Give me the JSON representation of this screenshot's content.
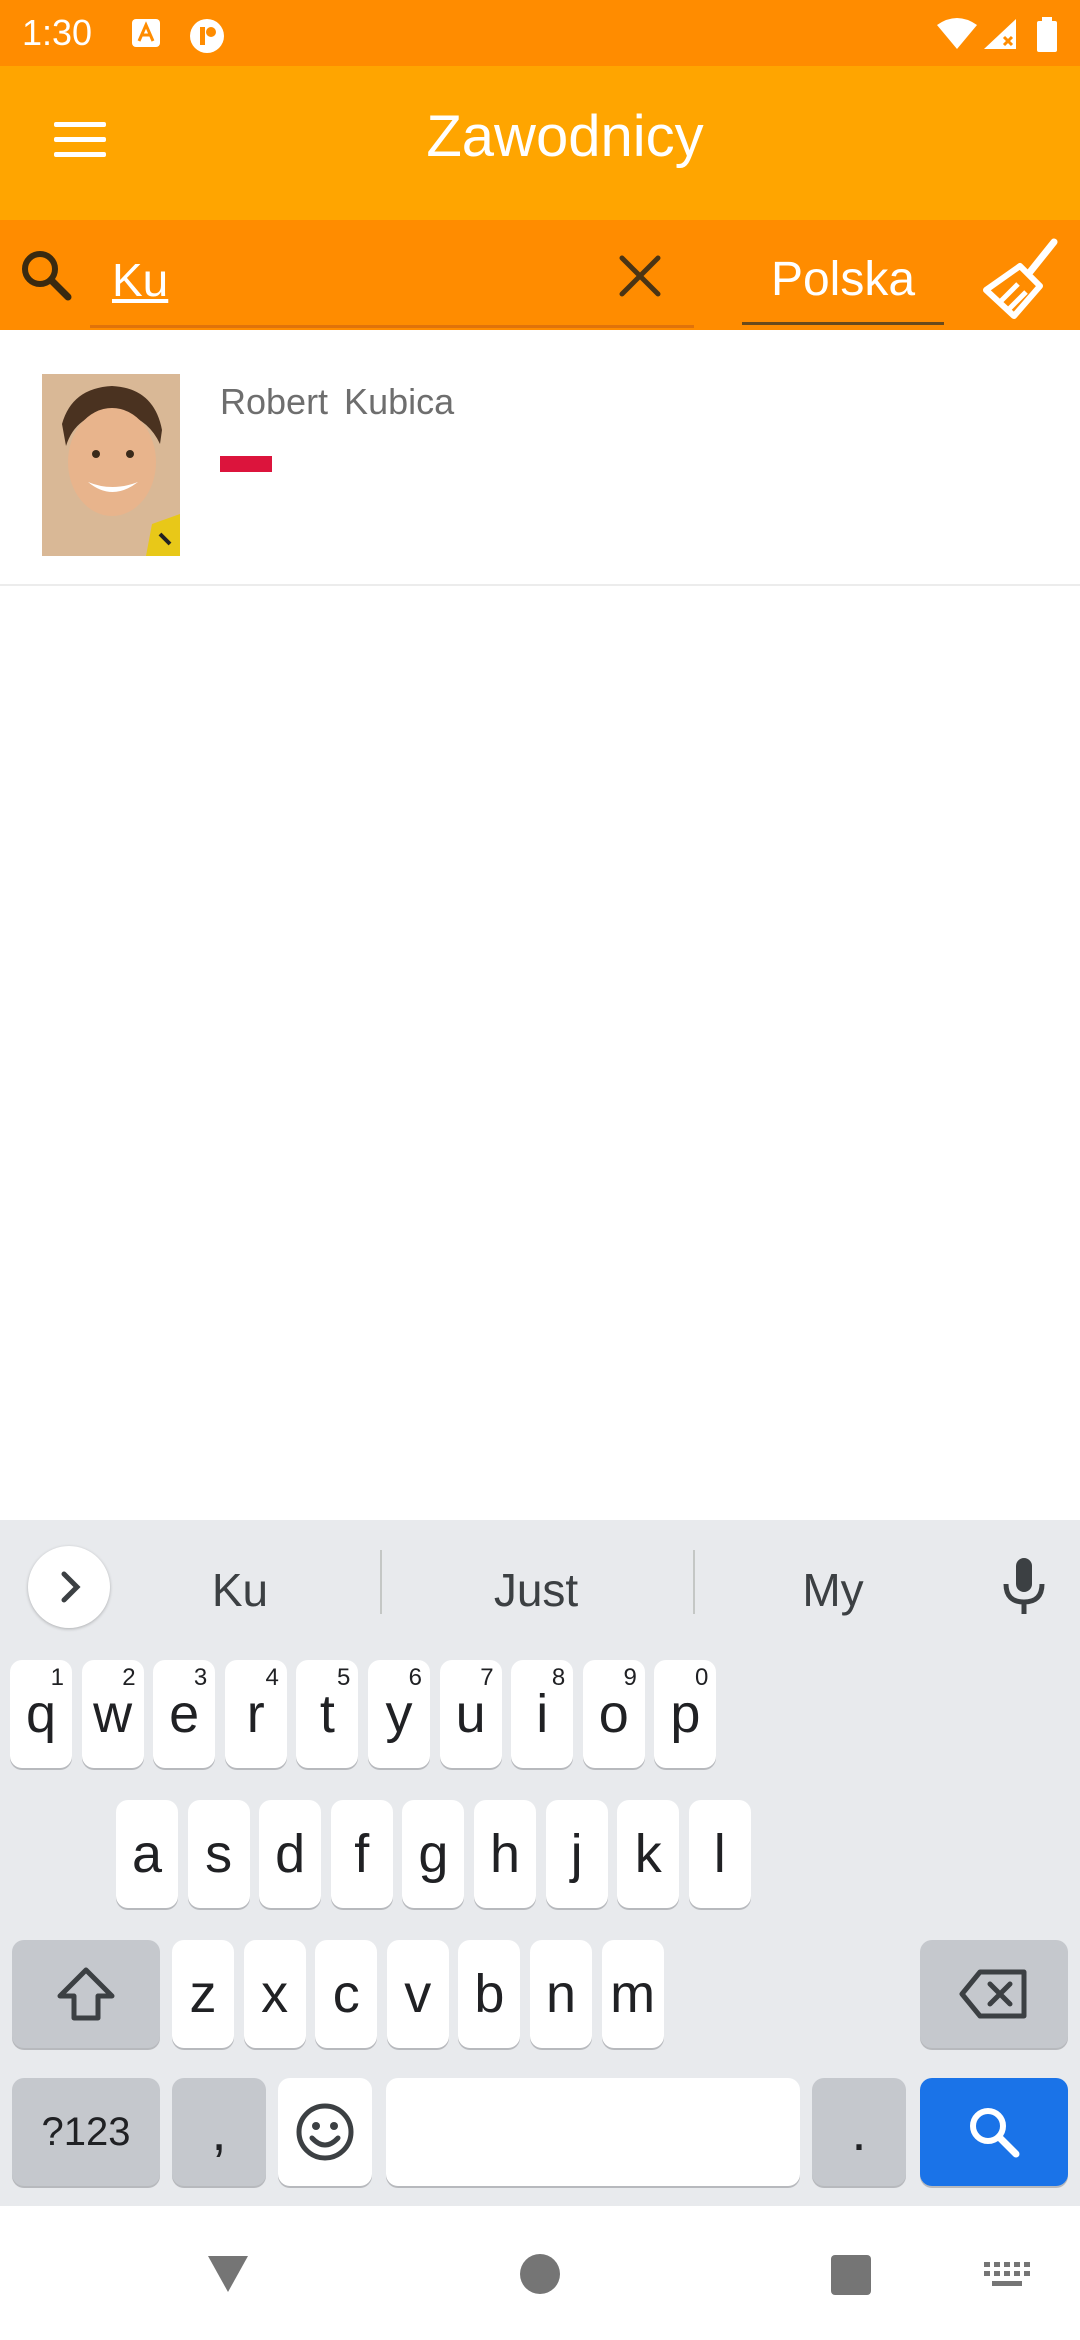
{
  "status_bar": {
    "time": "1:30"
  },
  "app_bar": {
    "title": "Zawodnicy"
  },
  "search": {
    "query": "Ku",
    "country": "Polska"
  },
  "results": [
    {
      "name": "Robert  Kubica"
    }
  ],
  "keyboard": {
    "suggestions": [
      "Ku",
      "Just",
      "My"
    ],
    "row1": [
      {
        "k": "q",
        "h": "1"
      },
      {
        "k": "w",
        "h": "2"
      },
      {
        "k": "e",
        "h": "3"
      },
      {
        "k": "r",
        "h": "4"
      },
      {
        "k": "t",
        "h": "5"
      },
      {
        "k": "y",
        "h": "6"
      },
      {
        "k": "u",
        "h": "7"
      },
      {
        "k": "i",
        "h": "8"
      },
      {
        "k": "o",
        "h": "9"
      },
      {
        "k": "p",
        "h": "0"
      }
    ],
    "row2": [
      "a",
      "s",
      "d",
      "f",
      "g",
      "h",
      "j",
      "k",
      "l"
    ],
    "row3": [
      "z",
      "x",
      "c",
      "v",
      "b",
      "n",
      "m"
    ],
    "symbols_label": "?123",
    "comma": ",",
    "period": "."
  },
  "colors": {
    "status_bar": "#ff8c00",
    "app_bar": "#ffa500",
    "search_row": "#ff8c00",
    "flag_red": "#dc143c",
    "search_key": "#1a73e8"
  }
}
